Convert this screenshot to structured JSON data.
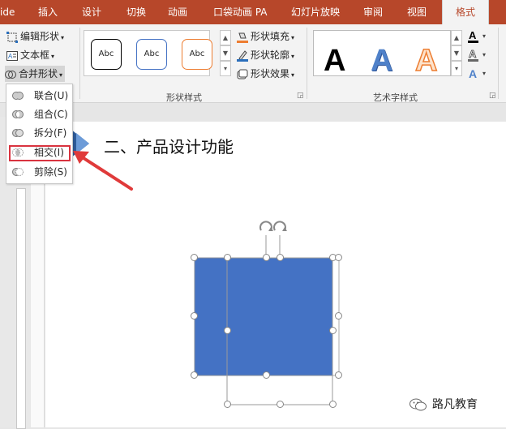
{
  "tabs": [
    {
      "label": "ide",
      "active": false
    },
    {
      "label": "插入",
      "active": false
    },
    {
      "label": "设计",
      "active": false
    },
    {
      "label": "切换",
      "active": false
    },
    {
      "label": "动画",
      "active": false
    },
    {
      "label": "口袋动画 PA",
      "active": false
    },
    {
      "label": "幻灯片放映",
      "active": false
    },
    {
      "label": "审阅",
      "active": false
    },
    {
      "label": "视图",
      "active": false
    },
    {
      "label": "格式",
      "active": true
    }
  ],
  "ribbon": {
    "insert_shapes": {
      "edit_shape": "编辑形状",
      "text_box": "文本框",
      "merge_shapes": "合并形状"
    },
    "shape_styles": {
      "label": "形状样式",
      "preset_text": "Abc",
      "shape_fill": "形状填充",
      "shape_outline": "形状轮廓",
      "shape_effects": "形状效果"
    },
    "wordart_styles": {
      "label": "艺术字样式",
      "preset_letter": "A"
    }
  },
  "merge_menu": {
    "items": [
      {
        "label": "联合(U)",
        "icon": "union-icon"
      },
      {
        "label": "组合(C)",
        "icon": "combine-icon"
      },
      {
        "label": "拆分(F)",
        "icon": "fragment-icon"
      },
      {
        "label": "相交(I)",
        "icon": "intersect-icon",
        "highlighted": true
      },
      {
        "label": "剪除(S)",
        "icon": "subtract-icon"
      }
    ]
  },
  "slide": {
    "title": "二、产品设计功能",
    "shape_fill_color": "#4472c4"
  },
  "watermark": {
    "text": "路凡教育",
    "icon": "wechat-icon"
  },
  "colors": {
    "tab_bar": "#b7472a",
    "highlight_border": "#d9333f",
    "arrow": "#e03a3a"
  }
}
